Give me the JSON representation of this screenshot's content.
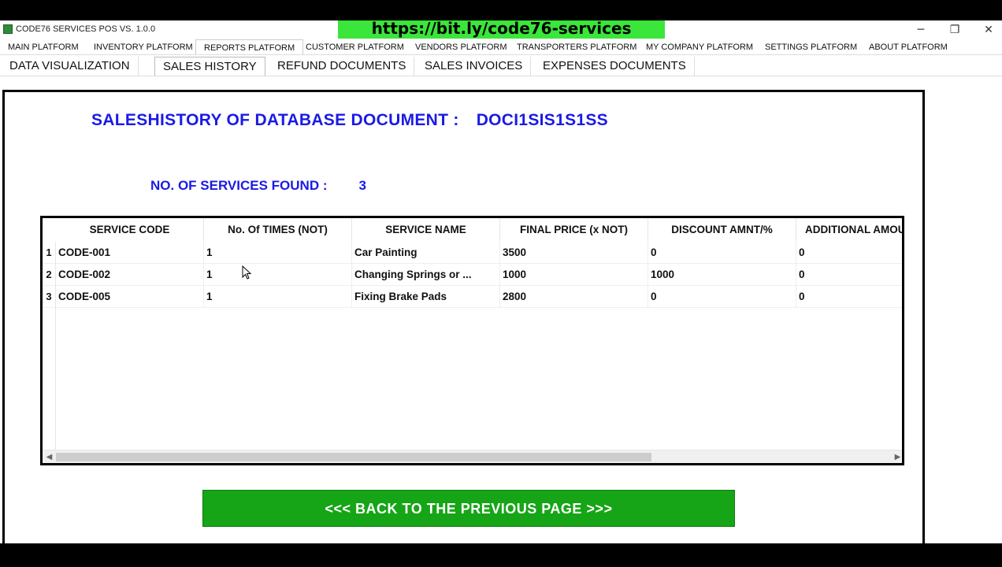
{
  "window": {
    "title": "CODE76 SERVICES POS VS. 1.0.0",
    "banner": "https://bit.ly/code76-services",
    "controls": {
      "minimize": "─",
      "restore": "❐",
      "close": "✕"
    }
  },
  "menu": {
    "items": [
      {
        "label": "MAIN PLATFORM"
      },
      {
        "label": "INVENTORY PLATFORM"
      },
      {
        "label": "REPORTS PLATFORM"
      },
      {
        "label": "CUSTOMER PLATFORM"
      },
      {
        "label": "VENDORS PLATFORM"
      },
      {
        "label": "TRANSPORTERS PLATFORM"
      },
      {
        "label": "MY COMPANY PLATFORM"
      },
      {
        "label": "SETTINGS PLATFORM"
      },
      {
        "label": "ABOUT PLATFORM"
      }
    ],
    "active": "REPORTS PLATFORM"
  },
  "subtabs": {
    "items": [
      {
        "label": "DATA VISUALIZATION"
      },
      {
        "label": "SALES HISTORY"
      },
      {
        "label": "REFUND DOCUMENTS"
      },
      {
        "label": "SALES INVOICES"
      },
      {
        "label": "EXPENSES DOCUMENTS"
      }
    ],
    "active": "SALES HISTORY"
  },
  "report": {
    "title": "SALESHISTORY  OF DATABASE DOCUMENT   :",
    "document_id": "DOCI1SIS1S1SS",
    "found_label": "NO. OF SERVICES FOUND   :",
    "found_count": "3"
  },
  "table": {
    "columns": [
      "SERVICE CODE",
      "No. Of TIMES (NOT)",
      "SERVICE NAME",
      "FINAL PRICE (x NOT)",
      "DISCOUNT AMNT/%",
      "ADDITIONAL AMOUNT"
    ],
    "rows": [
      {
        "num": "1",
        "cells": [
          "CODE-001",
          "1",
          "Car Painting",
          "3500",
          "0",
          "0"
        ]
      },
      {
        "num": "2",
        "cells": [
          "CODE-002",
          "1",
          "Changing Springs or ...",
          "1000",
          "1000",
          "0"
        ]
      },
      {
        "num": "3",
        "cells": [
          "CODE-005",
          "1",
          "Fixing Brake Pads",
          "2800",
          "0",
          "0"
        ]
      }
    ],
    "scroll": {
      "left_arrow": "◀",
      "right_arrow": "▶"
    }
  },
  "back_button": {
    "label": "<<<  BACK TO THE PREVIOUS PAGE >>>"
  },
  "colors": {
    "accent_blue": "#1a1ae6",
    "button_green": "#16a516",
    "banner_green": "#39e639"
  }
}
